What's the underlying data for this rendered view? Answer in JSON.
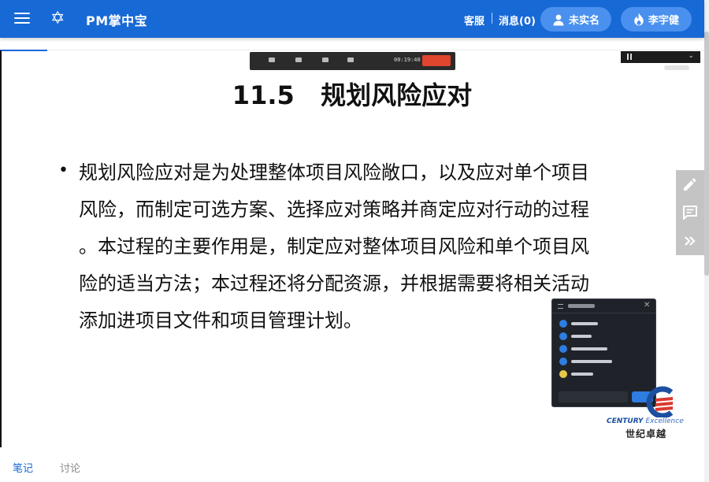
{
  "header": {
    "title": "PM掌中宝",
    "links": {
      "support": "客服",
      "messages": "消息(0)"
    },
    "verify_label": "未实名",
    "user_name": "李宇健",
    "colors": {
      "bar": "#1769d6",
      "pill": "#4a90ee"
    },
    "icons": [
      "menu-icon",
      "star-of-david-icon",
      "person-icon",
      "flame-icon"
    ]
  },
  "slide": {
    "title": "11.5   规划风险应对",
    "bullet": "•",
    "paragraph_lines": [
      "规划风险应对是为处理整体项目风险敞口，以及应对单个项目",
      "风险，而制定可选方案、选择应对策略并商定应对行动的过程",
      "。本过程的主要作用是，制定应对整体项目风险和单个项目风",
      "险的适当方法；本过程还将分配资源，并根据需要将相关活动",
      "添加进项目文件和项目管理计划。"
    ],
    "recording_time": "00:19:40",
    "logo_brand": "CENTURY",
    "logo_tagline": "Excellence",
    "logo_cn": "世纪卓越"
  },
  "side_tools": [
    "pencil-icon",
    "comment-icon",
    "double-chevron-right-icon"
  ],
  "tabs": {
    "notes": "笔记",
    "discussion": "讨论"
  }
}
